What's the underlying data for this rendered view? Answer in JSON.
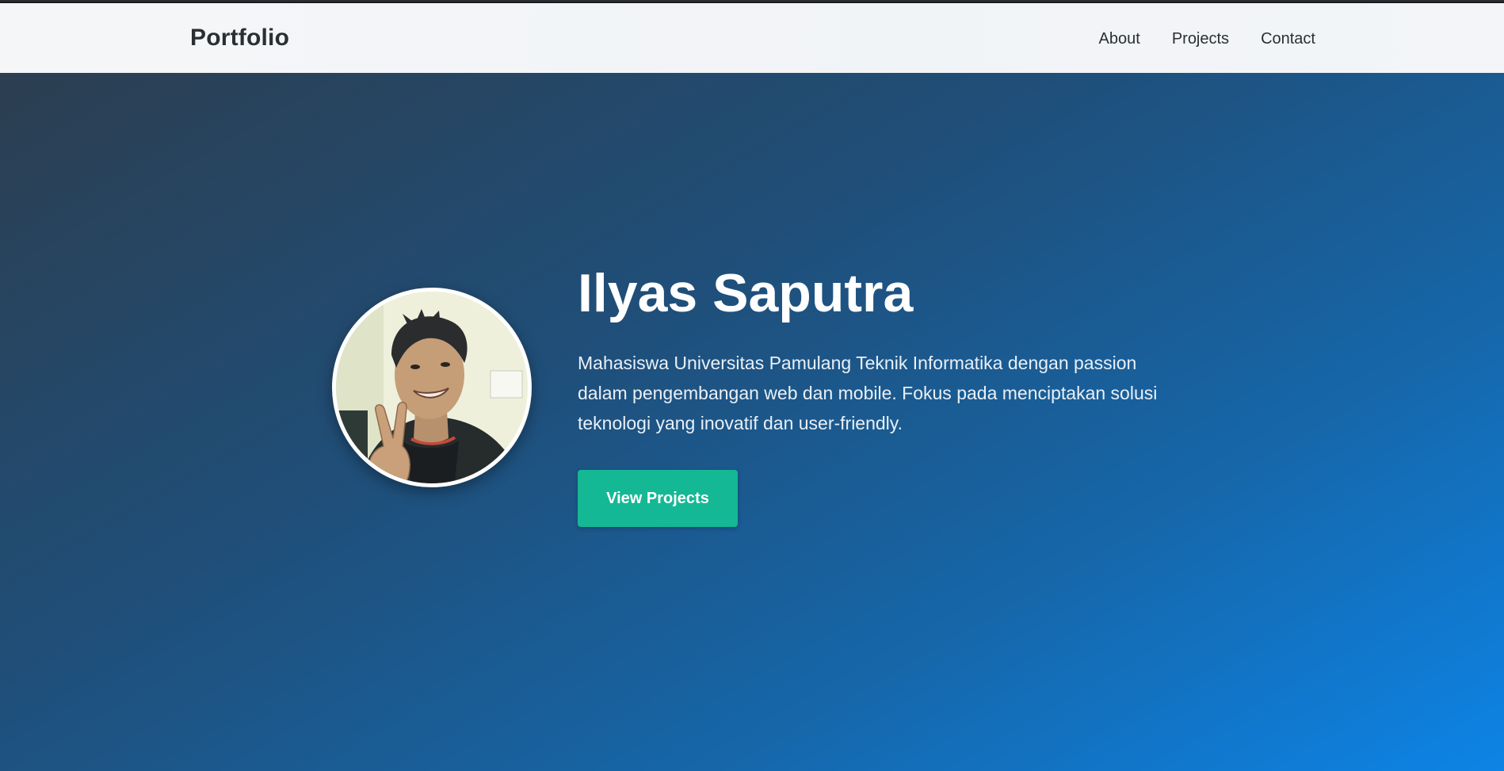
{
  "navbar": {
    "brand": "Portfolio",
    "links": [
      {
        "label": "About"
      },
      {
        "label": "Projects"
      },
      {
        "label": "Contact"
      }
    ]
  },
  "hero": {
    "name": "Ilyas Saputra",
    "description": "Mahasiswa Universitas Pamulang Teknik Informatika dengan passion dalam pengembangan web dan mobile. Fokus pada menciptakan solusi teknologi yang inovatif dan user-friendly.",
    "cta_label": "View Projects",
    "avatar_alt": "profile-photo"
  },
  "colors": {
    "navbar_bg": "#f3f5f8",
    "brand_text": "#2b2f33",
    "hero_gradient_start": "#2c3e50",
    "hero_gradient_end": "#0d84e6",
    "cta_bg": "#14b894",
    "text_light": "#ffffff"
  }
}
